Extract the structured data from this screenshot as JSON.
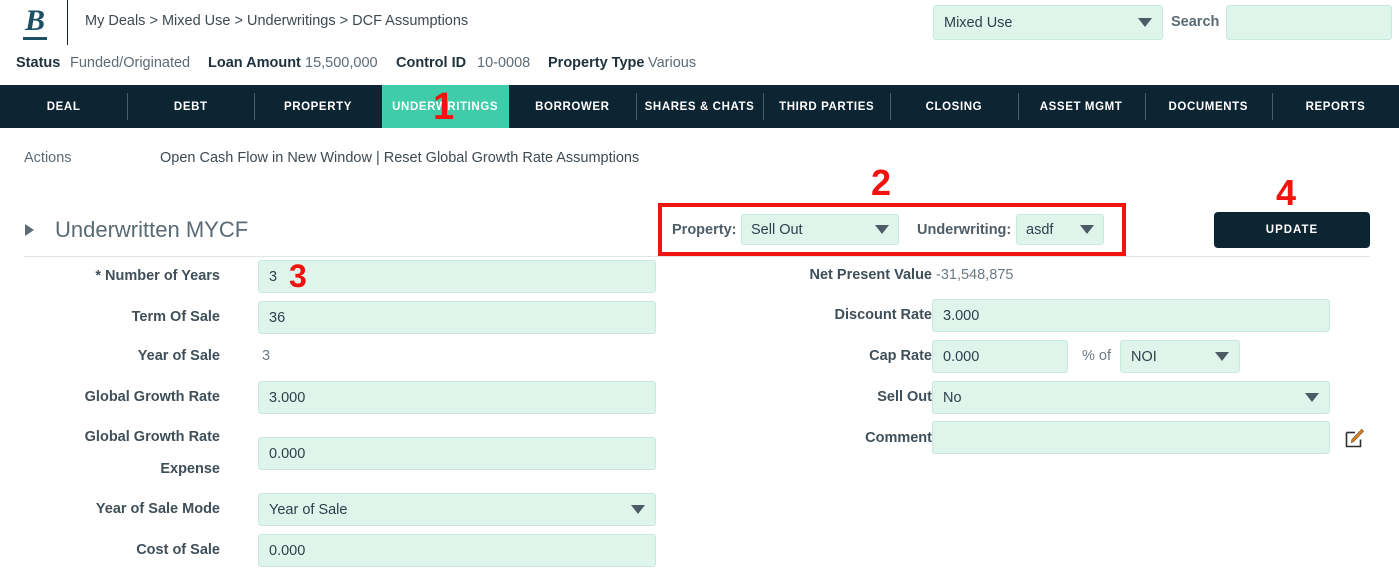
{
  "header": {
    "logo_text": "B",
    "breadcrumb": "My Deals > Mixed Use > Underwritings > DCF Assumptions",
    "property_select_value": "Mixed Use",
    "search_label": "Search",
    "search_value": "",
    "search_placeholder": ""
  },
  "status": {
    "status_key": "Status",
    "status_value": "Funded/Originated",
    "loan_key": "Loan Amount",
    "loan_value": "15,500,000",
    "control_key": "Control ID",
    "control_value": "10-0008",
    "ptype_key": "Property Type",
    "ptype_value": "Various"
  },
  "nav": {
    "tabs": [
      {
        "label": "DEAL",
        "active": false
      },
      {
        "label": "DEBT",
        "active": false
      },
      {
        "label": "PROPERTY",
        "active": false
      },
      {
        "label": "UNDERWRITINGS",
        "active": true
      },
      {
        "label": "BORROWER",
        "active": false
      },
      {
        "label": "SHARES & CHATS",
        "active": false
      },
      {
        "label": "THIRD PARTIES",
        "active": false
      },
      {
        "label": "CLOSING",
        "active": false
      },
      {
        "label": "ASSET MGMT",
        "active": false
      },
      {
        "label": "DOCUMENTS",
        "active": false
      },
      {
        "label": "REPORTS",
        "active": false
      }
    ]
  },
  "actions": {
    "label": "Actions",
    "links": "Open Cash Flow in New Window | Reset Global Growth Rate Assumptions"
  },
  "section": {
    "title": "Underwritten MYCF"
  },
  "selectors": {
    "property_label": "Property:",
    "property_value": "Sell Out",
    "underwriting_label": "Underwriting:",
    "underwriting_value": "asdf"
  },
  "toolbar": {
    "update_label": "UPDATE"
  },
  "left_form": {
    "number_of_years_label": "* Number of Years",
    "number_of_years_value": "3",
    "term_of_sale_label": "Term Of Sale",
    "term_of_sale_value": "36",
    "year_of_sale_label": "Year of Sale",
    "year_of_sale_value": "3",
    "global_growth_rate_label": "Global Growth Rate",
    "global_growth_rate_value": "3.000",
    "global_growth_rate_expense_label_1": "Global Growth Rate",
    "global_growth_rate_expense_label_2": "Expense",
    "global_growth_rate_expense_value": "0.000",
    "year_of_sale_mode_label": "Year of Sale Mode",
    "year_of_sale_mode_value": "Year of Sale",
    "cost_of_sale_label": "Cost of Sale",
    "cost_of_sale_value": "0.000"
  },
  "right_form": {
    "npv_label": "Net Present Value",
    "npv_value": "-31,548,875",
    "discount_rate_label": "Discount Rate",
    "discount_rate_value": "3.000",
    "cap_rate_label": "Cap Rate",
    "cap_rate_value": "0.000",
    "percent_of_label": "% of",
    "cap_rate_basis_value": "NOI",
    "sell_out_label": "Sell Out",
    "sell_out_value": "No",
    "comment_label": "Comment",
    "comment_value": ""
  },
  "annotations": [
    {
      "number": "1"
    },
    {
      "number": "2"
    },
    {
      "number": "3"
    },
    {
      "number": "4"
    }
  ],
  "colors": {
    "navy": "#0d2432",
    "teal_accent": "#3fcca8",
    "field_bg": "#dff5ec",
    "annotation_red": "#f2120e",
    "logo_teal": "#1b5065"
  }
}
